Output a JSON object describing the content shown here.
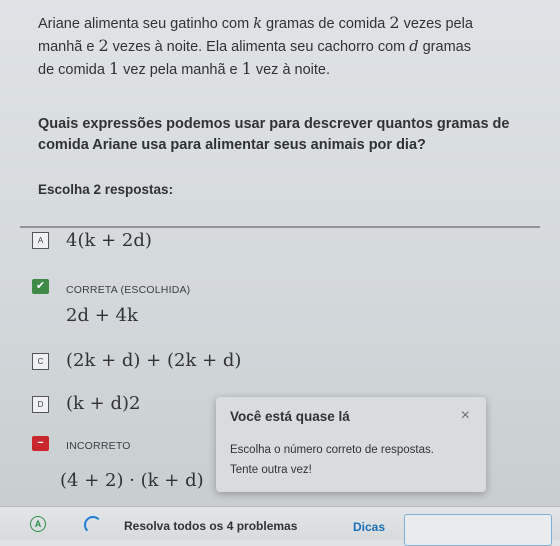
{
  "question": {
    "line1_pre": "Ariane alimenta seu gatinho com ",
    "var_k": "k",
    "line1_mid": " gramas de comida ",
    "num_2a": "2",
    "line1_post": " vezes pela",
    "line2_pre": "manhã e ",
    "num_2b": "2",
    "line2_mid": " vezes à noite. Ela alimenta seu cachorro com ",
    "var_d": "d",
    "line2_post": " gramas",
    "line3_pre": "de comida ",
    "num_1a": "1",
    "line3_mid": " vez pela manhã e ",
    "num_1b": "1",
    "line3_post": " vez à noite."
  },
  "prompt": "Quais expressões podemos usar para descrever quantos gramas de comida Ariane usa para alimentar seus animais por dia?",
  "choose_label": "Escolha 2 respostas:",
  "options": [
    {
      "letter": "A",
      "expr": "4(k + 2d)"
    },
    {
      "status": "CORRETA (ESCOLHIDA)",
      "expr": "2d + 4k"
    },
    {
      "letter": "C",
      "expr": "(2k + d) + (2k + d)"
    },
    {
      "letter": "D",
      "expr": "(k + d)2"
    },
    {
      "status": "INCORRETO",
      "expr": "(4 + 2) · (k + d)"
    }
  ],
  "popup": {
    "title": "Você está quase lá",
    "close": "×",
    "message": "Escolha o número correto de respostas.",
    "message2": "Tente outra vez!"
  },
  "bottom": {
    "badge": "A",
    "text": "Resolva todos os 4 problemas",
    "hints": "Dicas"
  }
}
